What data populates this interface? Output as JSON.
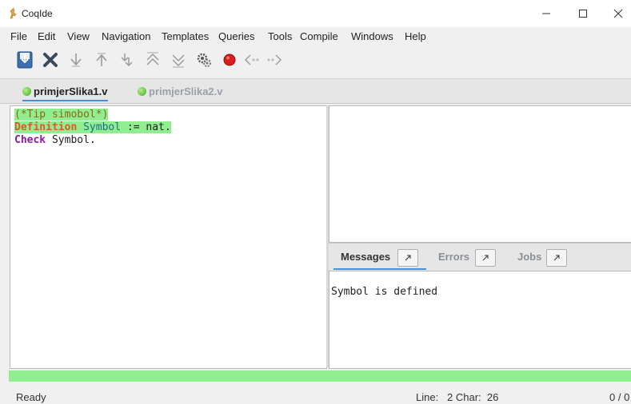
{
  "window": {
    "title": "CoqIde",
    "icon": "coq-rooster-icon"
  },
  "menu": [
    "File",
    "Edit",
    "View",
    "Navigation",
    "Templates",
    "Queries",
    "Tools",
    "Compile",
    "Windows",
    "Help"
  ],
  "toolbar": {
    "icons": [
      "save-icon",
      "close-icon",
      "forward-one-icon",
      "backward-one-icon",
      "go-to-cursor-icon",
      "restart-icon",
      "go-to-end-icon",
      "compute-gears-icon",
      "interrupt-icon",
      "previous-icon",
      "next-icon"
    ]
  },
  "file_tabs": [
    {
      "label": "primjerSlika1.v",
      "active": true
    },
    {
      "label": "primjerSlika2.v",
      "active": false
    }
  ],
  "editor": {
    "lines": [
      {
        "comment": "(*Tip simobol*)"
      },
      {
        "keyword": "Definition",
        "ident": "Symbol",
        "rest": " := nat."
      },
      {
        "keyword": "Check",
        "rest": " Symbol."
      }
    ]
  },
  "message_tabs": [
    {
      "label": "Messages",
      "active": true
    },
    {
      "label": "Errors",
      "active": false
    },
    {
      "label": "Jobs",
      "active": false
    }
  ],
  "messages": {
    "text": "Symbol is defined"
  },
  "progress": {
    "fraction": 1.0,
    "color": "#90ee90"
  },
  "status": {
    "ready": "Ready",
    "line_char": "Line:   2 Char:  26",
    "count": "0 / 0"
  },
  "colors": {
    "processed_bg": "#90ee90",
    "accent": "#4a8fd9"
  }
}
